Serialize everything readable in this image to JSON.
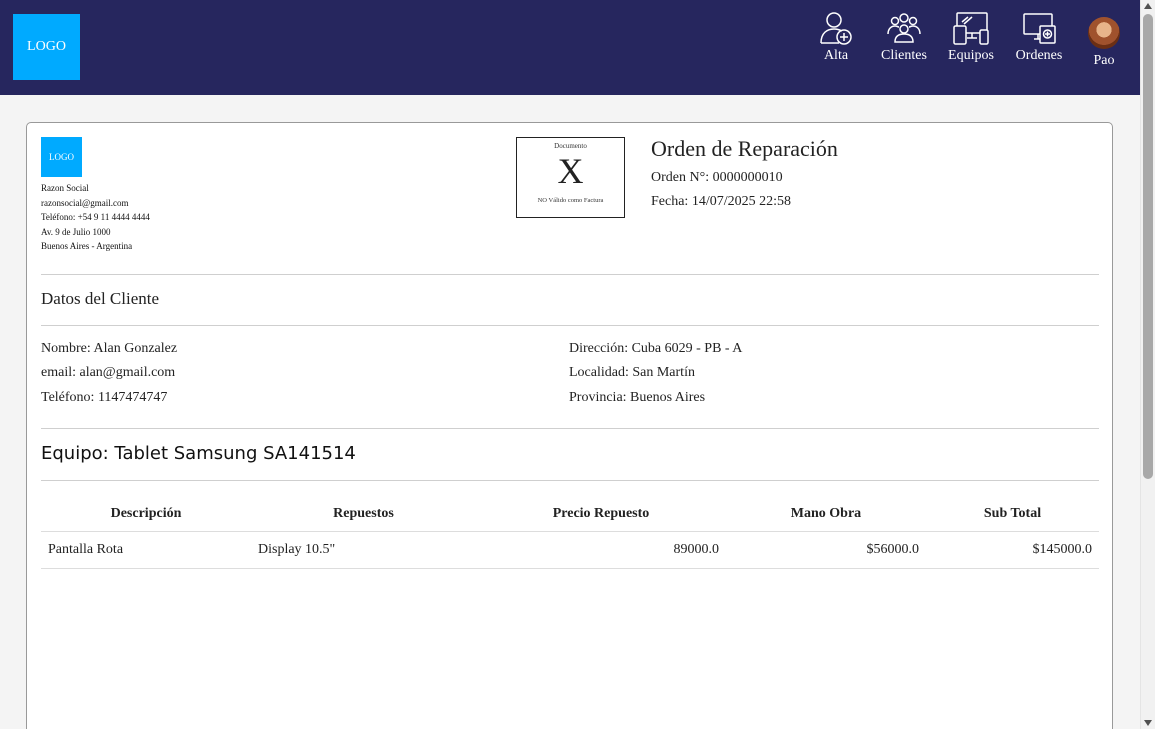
{
  "header": {
    "logo_text": "LOGO",
    "nav": [
      {
        "label": "Alta",
        "icon": "user-add-icon"
      },
      {
        "label": "Clientes",
        "icon": "users-group-icon"
      },
      {
        "label": "Equipos",
        "icon": "devices-icon"
      },
      {
        "label": "Ordenes",
        "icon": "orders-icon"
      }
    ],
    "user": {
      "name": "Pao",
      "icon": "avatar"
    }
  },
  "company": {
    "logo_text": "LOGO",
    "razon_social": "Razon Social",
    "email": "razonsocial@gmail.com",
    "telefono": "Teléfono: +54 9 11 4444 4444",
    "direccion": "Av. 9 de Julio 1000",
    "ciudad": "Buenos Aires - Argentina"
  },
  "document": {
    "label": "Documento",
    "letter": "X",
    "note": "NO Válido como Factura"
  },
  "order": {
    "title": "Orden de Reparación",
    "number": "Orden N°: 0000000010",
    "date": "Fecha: 14/07/2025 22:58"
  },
  "client": {
    "section_title": "Datos del Cliente",
    "nombre": "Nombre: Alan Gonzalez",
    "email": "email: alan@gmail.com",
    "telefono": "Teléfono: 1147474747",
    "direccion": "Dirección: Cuba 6029 - PB - A",
    "localidad": "Localidad: San Martín",
    "provincia": "Provincia: Buenos Aires"
  },
  "equipo": {
    "title": "Equipo: Tablet Samsung SA141514"
  },
  "table": {
    "headers": [
      "Descripción",
      "Repuestos",
      "Precio Repuesto",
      "Mano Obra",
      "Sub Total"
    ],
    "rows": [
      [
        "Pantalla Rota",
        "Display 10.5\"",
        "89000.0",
        "$56000.0",
        "$145000.0"
      ]
    ]
  }
}
